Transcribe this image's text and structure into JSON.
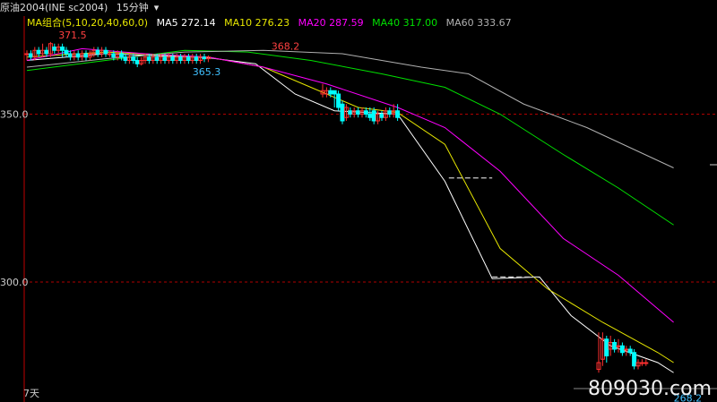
{
  "header": {
    "instrument": "原油2004(INE sc2004)",
    "period": "15分钟",
    "period_icon": "chevron-down-icon"
  },
  "ma_legend": {
    "group_label": "MA组合(5,10,20,40,60,0)",
    "items": [
      {
        "label": "MA5 272.14",
        "color": "#ffffff"
      },
      {
        "label": "MA10 276.23",
        "color": "#e6e600"
      },
      {
        "label": "MA20 287.59",
        "color": "#ff00ff"
      },
      {
        "label": "MA40 317.00",
        "color": "#00e000"
      },
      {
        "label": "MA60 333.67",
        "color": "#b0b0b0"
      }
    ]
  },
  "bottom_left": "7天",
  "watermark": "809030.com",
  "colors": {
    "up": "#ff3030",
    "down": "#00ffff",
    "grid": "#b00000",
    "axis": "#c00000"
  },
  "chart_data": {
    "type": "candlestick",
    "y_ticks": [
      {
        "value": 350.0,
        "label": "350.0"
      },
      {
        "value": 300.0,
        "label": "300.0"
      }
    ],
    "annotations": [
      {
        "label": "371.5",
        "x": 8,
        "y": 371.5,
        "color": "#ff4040"
      },
      {
        "label": "368.2",
        "x": 62,
        "y": 368.2,
        "color": "#ff4040"
      },
      {
        "label": "365.3",
        "x": 42,
        "y": 365.3,
        "color": "#40c0ff"
      },
      {
        "label": "268.2",
        "x": 164,
        "y": 268.2,
        "color": "#40c0ff"
      }
    ],
    "candles": [
      [
        0,
        368,
        368,
        366,
        369
      ],
      [
        1,
        368,
        367,
        366,
        369
      ],
      [
        2,
        367,
        369,
        366,
        370
      ],
      [
        3,
        369,
        368,
        367,
        370
      ],
      [
        4,
        368,
        369,
        367,
        371
      ],
      [
        5,
        369,
        368,
        367,
        370
      ],
      [
        6,
        368,
        371,
        367,
        371.5
      ],
      [
        7,
        370,
        369,
        368,
        371
      ],
      [
        8,
        369,
        370,
        368,
        371
      ],
      [
        9,
        370,
        369,
        367,
        371
      ],
      [
        10,
        369,
        368,
        367,
        370
      ],
      [
        11,
        368,
        367,
        366,
        369
      ],
      [
        12,
        367,
        368,
        366,
        369
      ],
      [
        13,
        368,
        367,
        366,
        369
      ],
      [
        14,
        367,
        368,
        366,
        369
      ],
      [
        15,
        368,
        367,
        366,
        369
      ],
      [
        16,
        367,
        368,
        366,
        369
      ],
      [
        17,
        368,
        369,
        367,
        370
      ],
      [
        18,
        369,
        368,
        367,
        370
      ],
      [
        19,
        368,
        369,
        367,
        370
      ],
      [
        20,
        369,
        368,
        367,
        370
      ],
      [
        21,
        368,
        368,
        367,
        369
      ],
      [
        22,
        368,
        367,
        366,
        369
      ],
      [
        23,
        367,
        368,
        366,
        369
      ],
      [
        24,
        368,
        367,
        366,
        369
      ],
      [
        25,
        367,
        366,
        365,
        368
      ],
      [
        26,
        366,
        367,
        365,
        368
      ],
      [
        27,
        367,
        366,
        365,
        368
      ],
      [
        28,
        366,
        365,
        364,
        367
      ],
      [
        29,
        365,
        366,
        364.5,
        367
      ],
      [
        30,
        366,
        367,
        365,
        368
      ],
      [
        31,
        367,
        366,
        365,
        368
      ],
      [
        32,
        366,
        367,
        365,
        368
      ],
      [
        33,
        367,
        366,
        365,
        368
      ],
      [
        34,
        366,
        367,
        365,
        368
      ],
      [
        35,
        367,
        366,
        365,
        368
      ],
      [
        36,
        366,
        367,
        365,
        368.2
      ],
      [
        37,
        367,
        366,
        365,
        368
      ],
      [
        38,
        366,
        367,
        365,
        368
      ],
      [
        39,
        367,
        366,
        365,
        368
      ],
      [
        40,
        366,
        367,
        365,
        368
      ],
      [
        41,
        367,
        366,
        365,
        368
      ],
      [
        42,
        366,
        367,
        365,
        368
      ],
      [
        43,
        367,
        366,
        365,
        368
      ],
      [
        44,
        366,
        367,
        365,
        368
      ],
      [
        45,
        367,
        366.5,
        365.5,
        368
      ],
      [
        46,
        366.5,
        367,
        365.5,
        367.5
      ],
      [
        75,
        356,
        357,
        355,
        359
      ],
      [
        76,
        356,
        357,
        355,
        358
      ],
      [
        77,
        357,
        356,
        355,
        358
      ],
      [
        78,
        357,
        356,
        352,
        357
      ],
      [
        79,
        356,
        352,
        351,
        357
      ],
      [
        80,
        353,
        348,
        347,
        354
      ],
      [
        81,
        349,
        352,
        348,
        353
      ],
      [
        82,
        351,
        350,
        349,
        352
      ],
      [
        83,
        350,
        351,
        349,
        352
      ],
      [
        84,
        351,
        350,
        349,
        352
      ],
      [
        85,
        350,
        351,
        349,
        352
      ],
      [
        86,
        351,
        350,
        349,
        352
      ],
      [
        87,
        350,
        349,
        348,
        352
      ],
      [
        88,
        351,
        348,
        347,
        352
      ],
      [
        89,
        348,
        350,
        347,
        351
      ],
      [
        90,
        350,
        349,
        348,
        351
      ],
      [
        91,
        349,
        351,
        348,
        352
      ],
      [
        92,
        351,
        350,
        349,
        352
      ],
      [
        93,
        350,
        351,
        349,
        353
      ],
      [
        94,
        351,
        349,
        348,
        353
      ],
      [
        145,
        274,
        276,
        273,
        285
      ],
      [
        146,
        277,
        283,
        275,
        285
      ],
      [
        147,
        283,
        278,
        276,
        284
      ],
      [
        148,
        280,
        282,
        278,
        284
      ],
      [
        149,
        282,
        280,
        279,
        283
      ],
      [
        150,
        281,
        281,
        279,
        283
      ],
      [
        151,
        281,
        279,
        278,
        282
      ],
      [
        152,
        280,
        280,
        278,
        281
      ],
      [
        153,
        280,
        279,
        278,
        281
      ],
      [
        154,
        279,
        275,
        274,
        280
      ],
      [
        155,
        275,
        276,
        274,
        277
      ],
      [
        156,
        276,
        276,
        275,
        277
      ],
      [
        157,
        276,
        276,
        275,
        277
      ]
    ],
    "dashes": [
      {
        "x0": 107,
        "x1": 118,
        "y": 331
      },
      {
        "x0": 118,
        "x1": 130,
        "y": 301.5
      }
    ],
    "series": [
      {
        "name": "MA5",
        "color": "#ffffff",
        "points": [
          [
            0,
            366
          ],
          [
            20,
            368
          ],
          [
            46,
            366.8
          ],
          [
            58,
            365
          ],
          [
            68,
            356
          ],
          [
            78,
            351
          ],
          [
            94,
            350
          ],
          [
            106,
            330
          ],
          [
            118,
            301
          ],
          [
            130,
            301.5
          ],
          [
            138,
            290
          ],
          [
            148,
            281
          ],
          [
            160,
            276
          ],
          [
            164,
            273
          ]
        ]
      },
      {
        "name": "MA10",
        "color": "#e6e600",
        "points": [
          [
            0,
            367
          ],
          [
            20,
            368.5
          ],
          [
            46,
            367
          ],
          [
            60,
            364
          ],
          [
            72,
            358
          ],
          [
            84,
            352
          ],
          [
            94,
            350.5
          ],
          [
            106,
            341
          ],
          [
            120,
            310
          ],
          [
            132,
            298
          ],
          [
            146,
            288
          ],
          [
            160,
            279
          ],
          [
            164,
            276
          ]
        ]
      },
      {
        "name": "MA20",
        "color": "#ff00ff",
        "points": [
          [
            0,
            366
          ],
          [
            14,
            369.5
          ],
          [
            30,
            368
          ],
          [
            46,
            367
          ],
          [
            60,
            364
          ],
          [
            76,
            359
          ],
          [
            94,
            352
          ],
          [
            106,
            346
          ],
          [
            120,
            333
          ],
          [
            136,
            313
          ],
          [
            150,
            302
          ],
          [
            164,
            288
          ]
        ]
      },
      {
        "name": "MA40",
        "color": "#00e000",
        "points": [
          [
            0,
            363
          ],
          [
            20,
            366
          ],
          [
            40,
            369
          ],
          [
            56,
            368.5
          ],
          [
            72,
            366
          ],
          [
            90,
            362
          ],
          [
            106,
            358
          ],
          [
            120,
            350
          ],
          [
            136,
            338
          ],
          [
            150,
            328
          ],
          [
            164,
            317
          ]
        ]
      },
      {
        "name": "MA60",
        "color": "#b0b0b0",
        "points": [
          [
            0,
            364
          ],
          [
            20,
            366.5
          ],
          [
            40,
            368.5
          ],
          [
            60,
            369
          ],
          [
            80,
            368
          ],
          [
            100,
            364
          ],
          [
            112,
            362
          ],
          [
            126,
            353
          ],
          [
            142,
            346
          ],
          [
            164,
            334
          ]
        ]
      }
    ]
  }
}
